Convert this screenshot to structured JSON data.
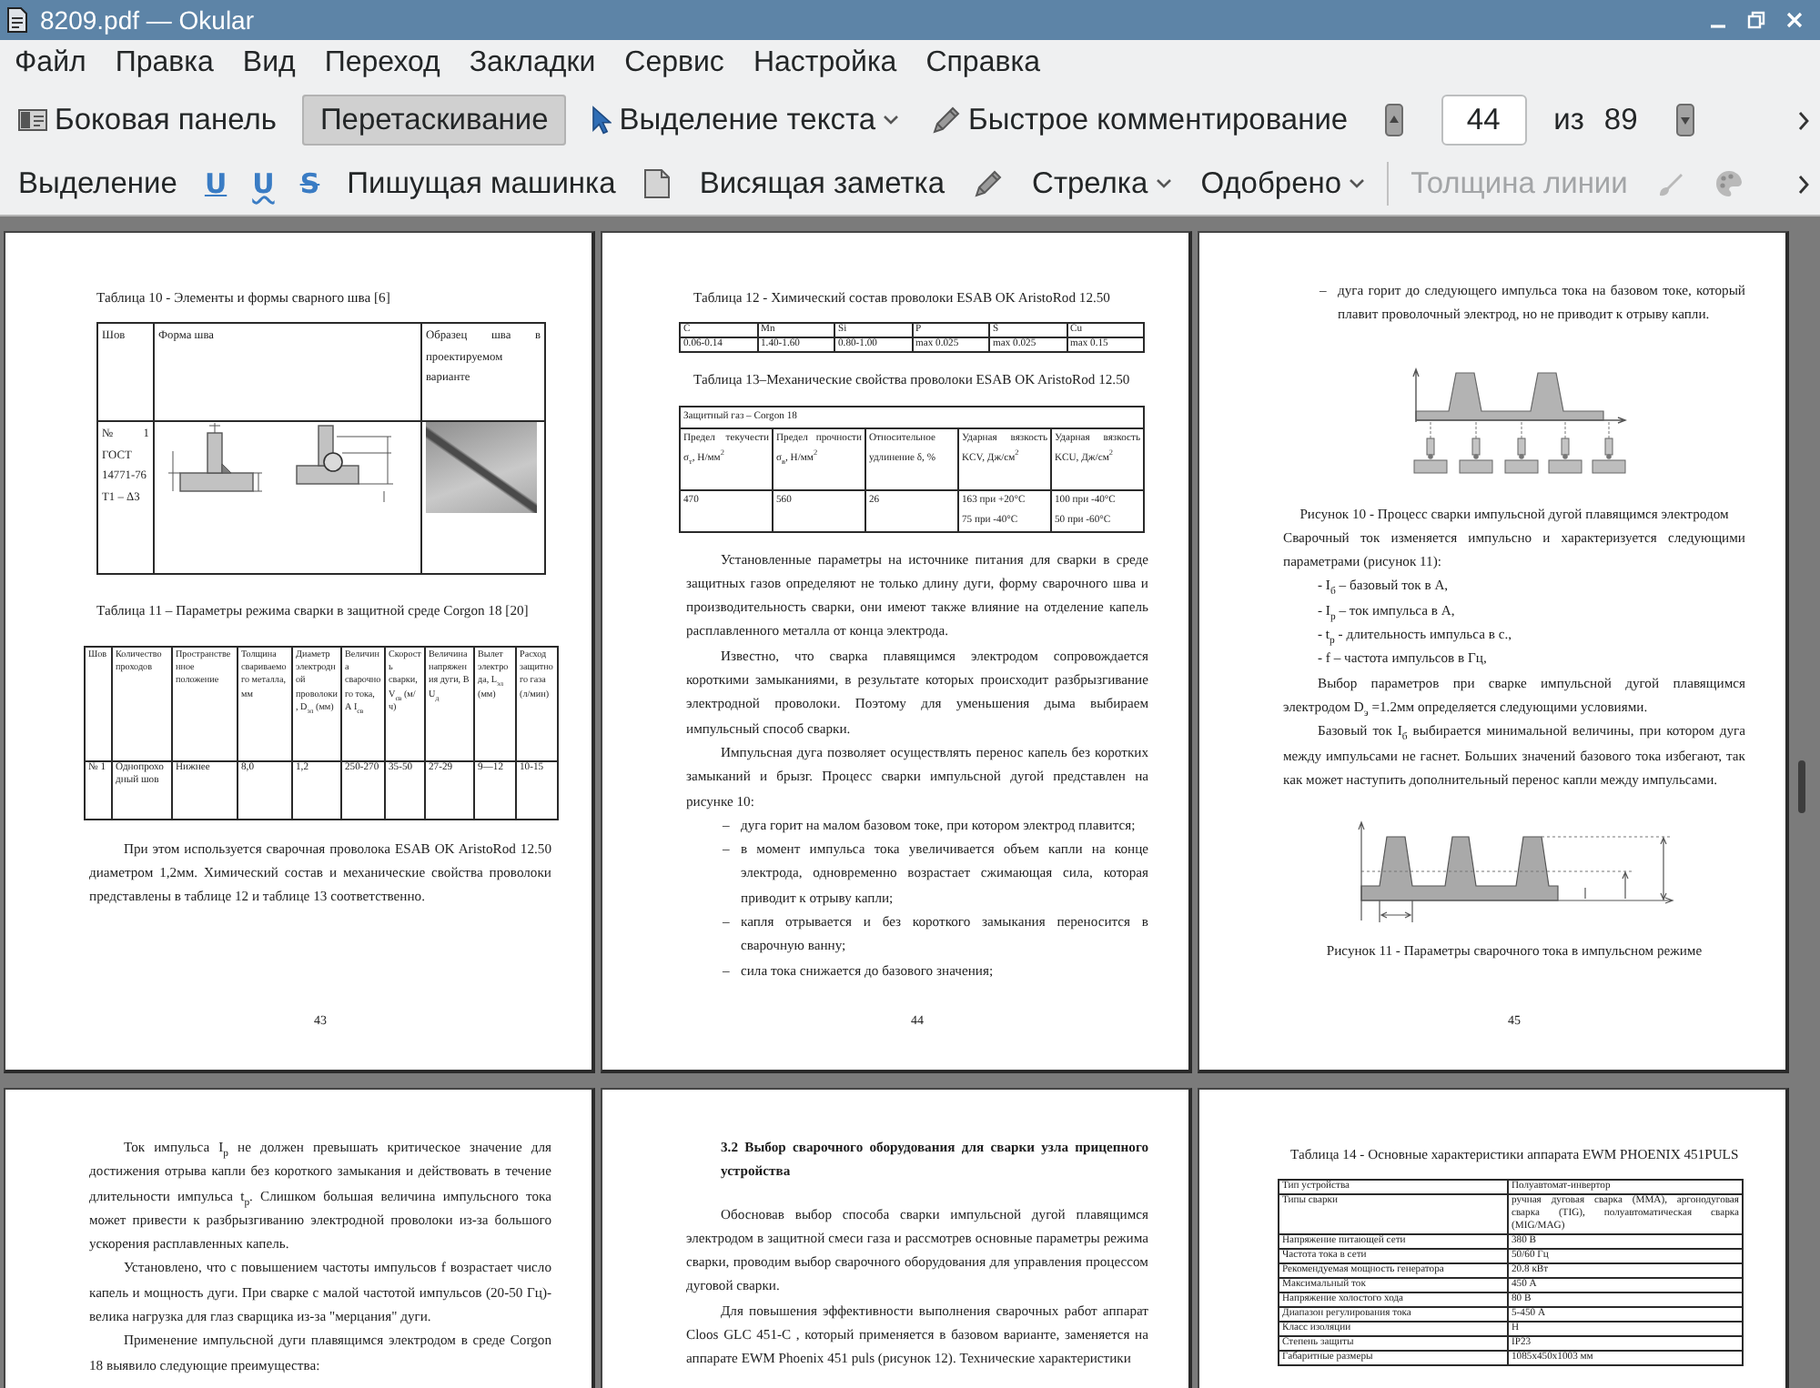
{
  "window": {
    "title": "8209.pdf — Okular"
  },
  "menu": [
    "Файл",
    "Правка",
    "Вид",
    "Переход",
    "Закладки",
    "Сервис",
    "Настройка",
    "Справка"
  ],
  "main_toolbar": [
    {
      "kind": "button",
      "label": "Боковая панель",
      "selected": false
    },
    {
      "kind": "button",
      "label": "Перетаскивание",
      "selected": true
    },
    {
      "kind": "menu",
      "label": "Выделение текста",
      "selected": false
    },
    {
      "kind": "button",
      "label": "Быстрое комментирование",
      "selected": false
    }
  ],
  "page_navigation": {
    "value": "44",
    "of": "из",
    "total": "89"
  },
  "annotation_toolbar": [
    {
      "kind": "button",
      "label": "Выделение",
      "disabled": false
    },
    {
      "kind": "glyph",
      "label": "U",
      "disabled": false
    },
    {
      "kind": "glyph",
      "label": "U",
      "disabled": false
    },
    {
      "kind": "glyph",
      "label": "S",
      "disabled": false
    },
    {
      "kind": "button",
      "label": "Пишущая машинка",
      "disabled": false
    },
    {
      "kind": "icon",
      "disabled": false
    },
    {
      "kind": "button",
      "label": "Висящая заметка",
      "disabled": false
    },
    {
      "kind": "icon",
      "disabled": false
    },
    {
      "kind": "menu",
      "label": "Стрелка",
      "disabled": false
    },
    {
      "kind": "menu",
      "label": "Одобрено",
      "disabled": false
    },
    {
      "kind": "separator"
    },
    {
      "kind": "button",
      "label": "Толщина линии",
      "disabled": true
    },
    {
      "kind": "icon",
      "disabled": true
    },
    {
      "kind": "icon",
      "disabled": true
    }
  ],
  "pages": [
    {
      "number": "43",
      "blocks": [
        {
          "kind": "caption",
          "text": "Таблица 10 - Элементы и формы сварного шва [6]"
        },
        {
          "kind": "weldtable",
          "columns": [
            "Шов",
            "Форма шва",
            "Образец шва в проектируемом варианте"
          ],
          "rows": [
            [
              {
                "kind": "text",
                "text": "№ 1 ГОСТ 14771-76 Т1 – Δ3"
              },
              {
                "kind": "sketch"
              },
              {
                "kind": "photo"
              }
            ]
          ]
        },
        {
          "kind": "caption",
          "text": "Таблица 11 – Параметры режима сварки в защитной среде Corgon 18 [20]"
        },
        {
          "kind": "paramtable",
          "columns": [
            "Шов",
            "Количество проходов",
            "Пространственное положение",
            "Толщина свариваемого металла, мм",
            "Диаметр электродной проволоки, D$_{эл}$ (мм)",
            "Величина сварочного тока, А I$_{св}$",
            "Скорость сварки, V$_{св}$ (м/ч)",
            "Величина напряжения дуги, В U$_{д}$",
            "Вылет электрода, L$_{эл}$ (мм)",
            "Расход защитного газа (л/мин)"
          ],
          "rows": [
            [
              "№ 1",
              "Однопроходный шов",
              "Нижнее",
              "8,0",
              "1,2",
              "250-270",
              "35-50",
              "27-29",
              "9—12",
              "10-15"
            ]
          ]
        },
        {
          "kind": "paragraph",
          "text": "При этом используется сварочная проволока ESAB OK AristoRod 12.50 диаметром 1,2мм. Химический состав и механические свойства проволоки представлены в таблице 12 и таблице 13 соответственно."
        }
      ]
    },
    {
      "number": "44",
      "blocks": [
        {
          "kind": "caption",
          "text": "Таблица 12 - Химический состав проволоки ESAB OK AristoRod 12.50"
        },
        {
          "kind": "gridtable",
          "columns": [
            "C",
            "Mn",
            "Si",
            "P",
            "S",
            "Cu"
          ],
          "rows": [
            [
              "0.06-0.14",
              "1.40-1.60",
              "0.80-1.00",
              "max 0.025",
              "max 0.025",
              "max 0.15"
            ]
          ]
        },
        {
          "kind": "caption",
          "text": "Таблица 13–Механические свойства проволоки ESAB OK AristoRod 12.50"
        },
        {
          "kind": "proptable",
          "group": "Защитный газ – Corgon 18",
          "columns": [
            "Предел текучести σ$_{т}$, Н/мм$^{2}$",
            "Предел прочности σ$_{в}$, Н/мм$^{2}$",
            "Относительное удлинение δ, %",
            "Ударная вязкость KCV, Дж/см$^{2}$",
            "Ударная вязкость KCU, Дж/см$^{2}$"
          ],
          "rows": [
            [
              "470",
              "560",
              "26",
              [
                "163 при +20°C",
                "75 при -40°C"
              ],
              [
                "100 при -40°C",
                "50 при -60°C"
              ]
            ]
          ]
        },
        {
          "kind": "paragraph",
          "text": "Установленные параметры на источнике питания для сварки в среде защитных газов определяют не только длину дуги, форму сварочного шва и производительность сварки, они имеют также влияние на отделение капель расплавленного металла от конца электрода."
        },
        {
          "kind": "paragraph",
          "text": "Известно, что сварка плавящимся электродом сопровождается короткими замыканиями, в результате которых происходит разбрызгивание электродной проволоки. Поэтому для уменьшения дыма выбираем импульсный способ сварки."
        },
        {
          "kind": "paragraph",
          "text": "Импульсная дуга позволяет осуществлять перенос капель без коротких замыканий и брызг. Процесс сварки импульсной дугой представлен на рисунке 10:"
        },
        {
          "kind": "item",
          "marker": "–",
          "text": "дуга горит на малом базовом токе, при котором электрод плавится;"
        },
        {
          "kind": "item",
          "marker": "–",
          "text": "в момент импульса тока увеличивается объем капли на конце электрода, одновременно возрастает сжимающая сила, которая приводит к отрыву капли;"
        },
        {
          "kind": "item",
          "marker": "–",
          "text": "капля отрывается и без короткого замыкания переносится в сварочную ванну;"
        },
        {
          "kind": "item",
          "marker": "–",
          "text": "сила тока снижается до базового значения;"
        }
      ]
    },
    {
      "number": "45",
      "blocks": [
        {
          "kind": "item",
          "marker": "–",
          "text": "дуга горит до следующего импульса тока на базовом токе, который плавит проволочный электрод, но не приводит к отрыву капли."
        },
        {
          "kind": "diagram"
        },
        {
          "kind": "figcaption",
          "text": "Рисунок 10 - Процесс сварки импульсной дугой плавящимся электродом"
        },
        {
          "kind": "plain",
          "text": "Сварочный ток изменяется импульсно и характеризуется следующими параметрами (рисунок 11):"
        },
        {
          "kind": "paragraph",
          "text": "- I$_{б}$ – базовый ток в А,"
        },
        {
          "kind": "paragraph",
          "text": "- I$_{р}$ – ток импульса в А,"
        },
        {
          "kind": "paragraph",
          "text": "- t$_{р}$ - длительность импульса в с.,"
        },
        {
          "kind": "paragraph",
          "text": "- f – частота импульсов в Гц,"
        },
        {
          "kind": "paragraph",
          "text": "Выбор параметров при сварке импульсной дугой плавящимся электродом D$_{э}$ =1.2мм определяется следующими условиями."
        },
        {
          "kind": "paragraph",
          "text": "Базовый ток I$_{б}$ выбирается минимальной величины, при котором дуга между импульсами не гаснет. Больших значений базового тока избегают, так как может наступить дополнительный перенос капли между импульсами."
        },
        {
          "kind": "graph"
        },
        {
          "kind": "figcaption",
          "text": "Рисунок 11 - Параметры сварочного тока в импульсном режиме"
        }
      ]
    },
    {
      "blocks": [
        {
          "kind": "paragraph",
          "text": "Ток импульса I$_{р}$ не должен превышать критическое значение для достижения отрыва капли без короткого замыкания и действовать в течение длительности импульса t$_{р}$. Слишком большая величина импульсного тока может привести к разбрызгиванию электродной проволоки из-за большого ускорения расплавленных капель."
        },
        {
          "kind": "paragraph",
          "text": "Установлено, что с повышением частоты импульсов f возрастает число капель и мощность дуги. При сварке с малой частотой импульсов (20-50 Гц)- велика нагрузка для глаз сварщика из-за \"мерцания\" дуги."
        },
        {
          "kind": "paragraph",
          "text": "Применение импульсной дуги плавящимся электродом в среде Corgon 18 выявило следующие преимущества:"
        }
      ]
    },
    {
      "blocks": [
        {
          "kind": "heading",
          "text": "3.2 Выбор сварочного оборудования для сварки узла прицепного устройства"
        },
        {
          "kind": "paragraph",
          "text": "Обосновав выбор способа сварки импульсной дугой плавящимся электродом в защитной смеси газа и рассмотрев основные параметры режима сварки, проводим выбор сварочного оборудования для управления процессом дуговой сварки."
        },
        {
          "kind": "paragraph",
          "text": "Для повышения эффективности выполнения сварочных работ аппарат Cloos GLC 451-C , который применяется в базовом варианте, заменяется на аппарате EWM Phoenix 451 puls (рисунок 12). Технические характеристики"
        }
      ]
    },
    {
      "blocks": [
        {
          "kind": "caption",
          "text": "Таблица 14 - Основные характеристики аппарата EWM PHOENIX 451PULS"
        },
        {
          "kind": "spectable",
          "rows": [
            [
              "Тип устройства",
              "Полуавтомат-инвертор"
            ],
            [
              "Типы сварки",
              "ручная дуговая сварка (MMA), аргонодуговая сварка (TIG), полуавтоматическая сварка (MIG/MAG)"
            ],
            [
              "Напряжение питающей сети",
              "380 В"
            ],
            [
              "Частота тока в сети",
              "50/60 Гц"
            ],
            [
              "Рекомендуемая мощность генератора",
              "20.8 кВт"
            ],
            [
              "Максимальный ток",
              "450 А"
            ],
            [
              "Напряжение холостого хода",
              "80 В"
            ],
            [
              "Диапазон регулирования тока",
              "5-450 А"
            ],
            [
              "Класс изоляции",
              "H"
            ],
            [
              "Степень защиты",
              "IP23"
            ],
            [
              "Габаритные размеры",
              "1085х450х1003 мм"
            ]
          ]
        }
      ]
    }
  ]
}
